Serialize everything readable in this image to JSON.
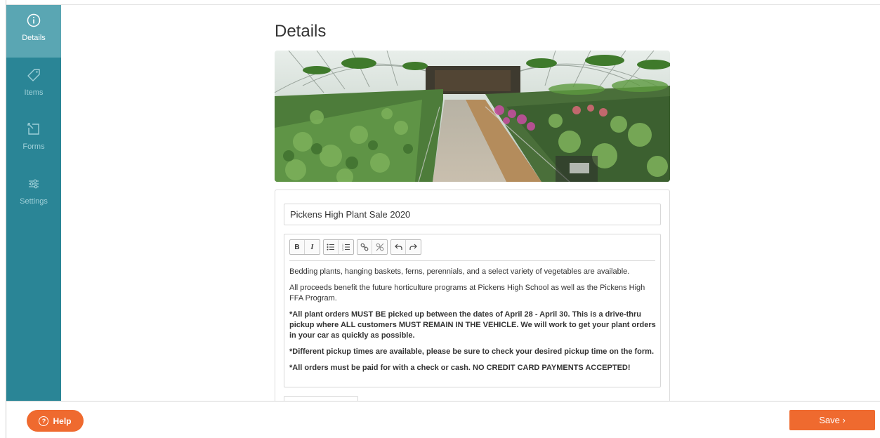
{
  "sidebar": {
    "items": [
      {
        "label": "Details",
        "icon": "info-icon"
      },
      {
        "label": "Items",
        "icon": "tag-icon"
      },
      {
        "label": "Forms",
        "icon": "form-icon"
      },
      {
        "label": "Settings",
        "icon": "sliders-icon"
      }
    ]
  },
  "page": {
    "title": "Details"
  },
  "form": {
    "name_value": "Pickens High Plant Sale 2020",
    "toolbar": {
      "bold": "B",
      "italic": "I"
    },
    "description": {
      "p1": "Bedding plants, hanging baskets, ferns, perennials, and a select variety of vegetables are available.",
      "p2": "All proceeds benefit the future horticulture programs at Pickens High School as well as the Pickens High FFA Program.",
      "p3": "*All plant orders MUST BE picked up between the dates of April 28 - April 30. This is a drive-thru pickup where ALL customers MUST REMAIN IN THE VEHICLE. We will work to get your plant orders in your car as quickly as possible.",
      "p4": "*Different pickup times are available, please be sure to check your desired pickup time on the form.",
      "p5": "*All orders must be paid for with a check or cash. NO CREDIT CARD PAYMENTS ACCEPTED!"
    }
  },
  "footer": {
    "help_label": "Help",
    "save_label": "Save ›"
  },
  "colors": {
    "sidebar": "#2a8596",
    "sidebar_active": "#5aa6b3",
    "accent": "#ef6a2f"
  }
}
